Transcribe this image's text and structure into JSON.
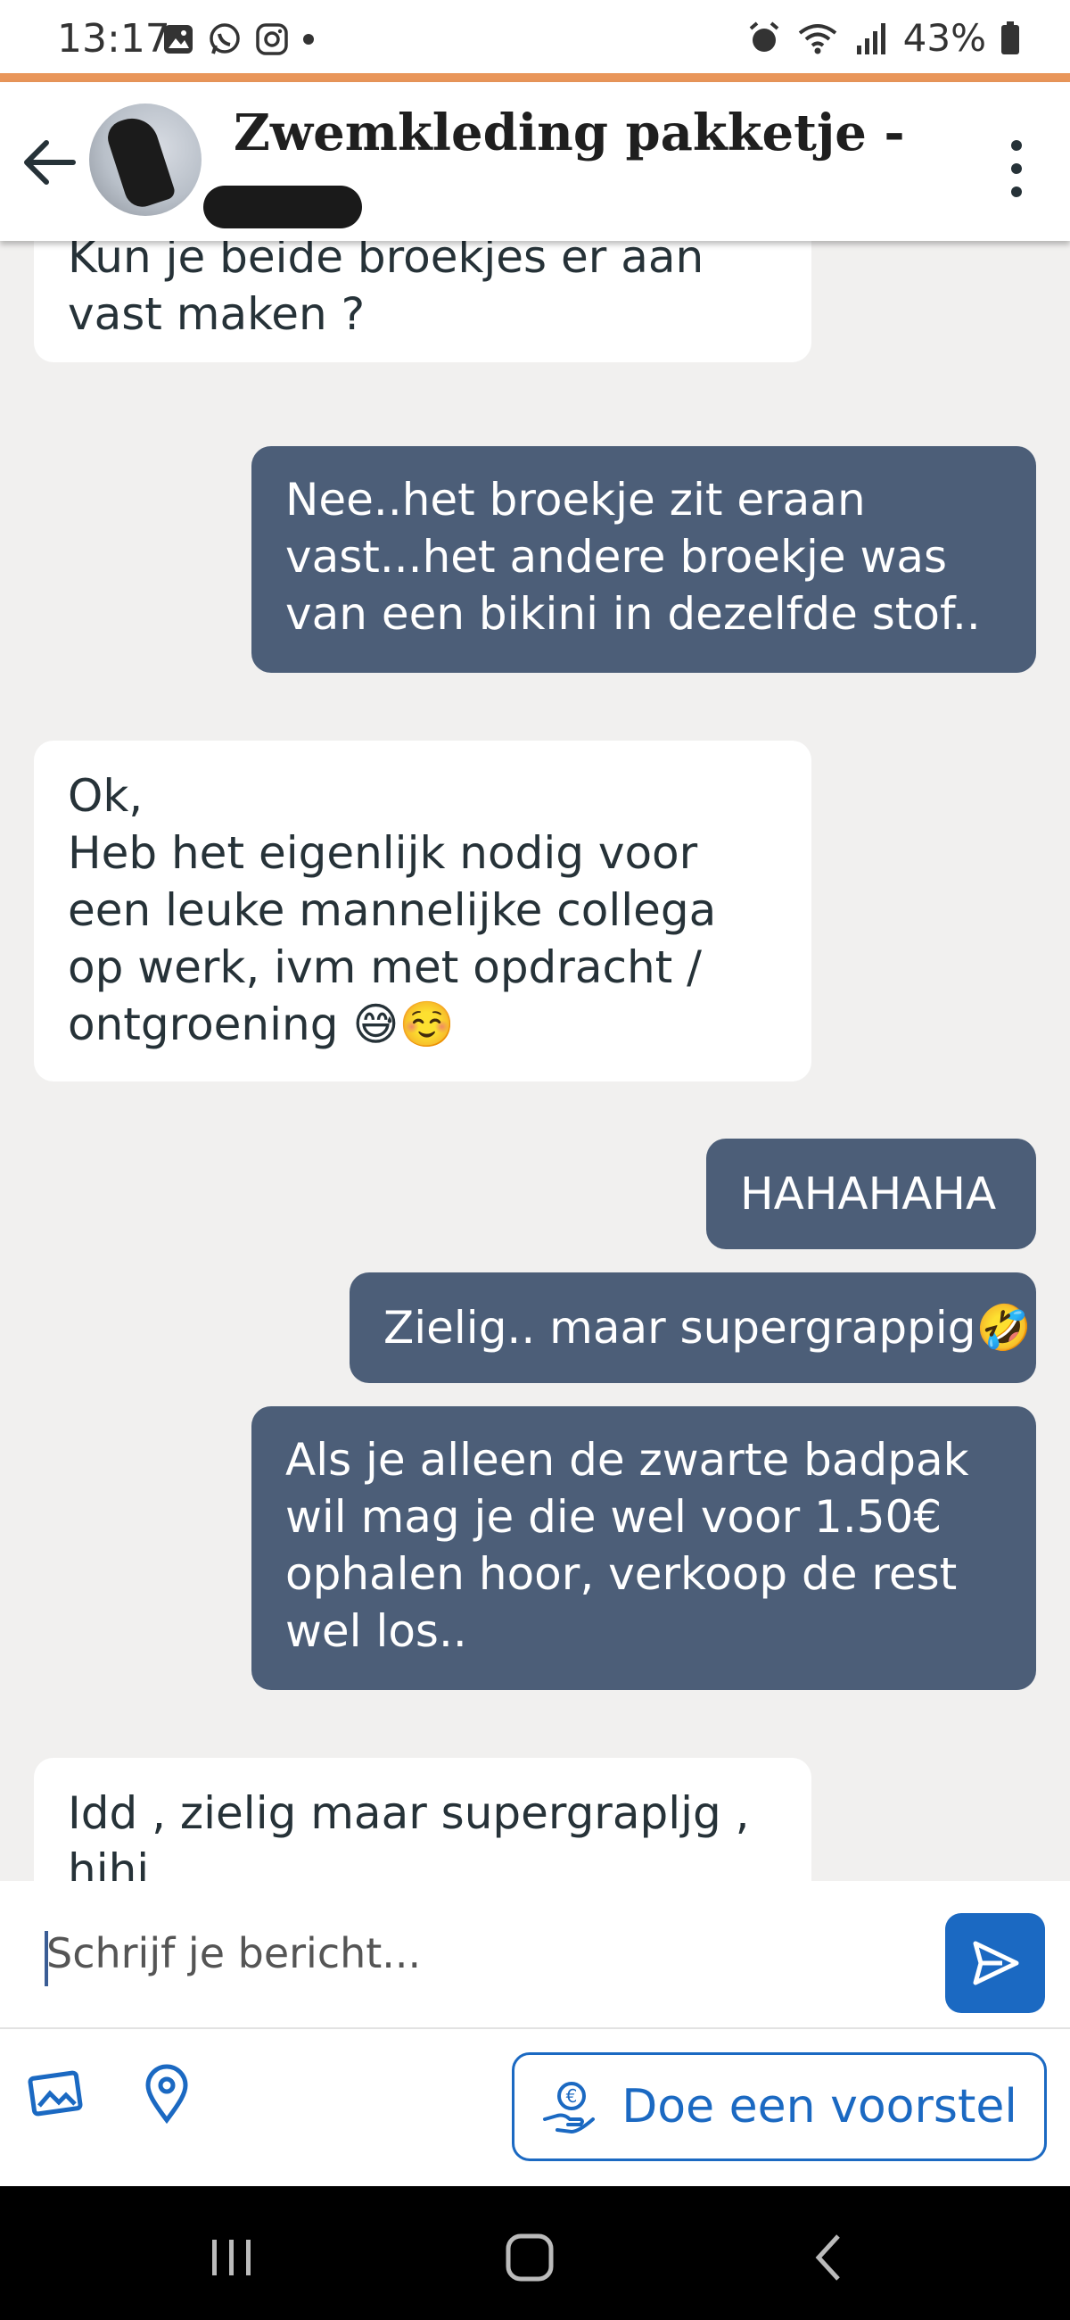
{
  "status_bar": {
    "time": "13:17",
    "battery": "43%"
  },
  "header": {
    "title": "Zwemkleding pakketje - €...",
    "back_icon": "arrow-left-icon",
    "menu_icon": "kebab-menu-icon"
  },
  "messages": [
    {
      "side": "in",
      "text": "Kun je beide broekjes er aan\nvast maken ?"
    },
    {
      "side": "out",
      "text": "Nee..het broekje zit eraan\nvast...het andere broekje was\nvan een bikini in dezelfde stof.."
    },
    {
      "side": "in",
      "text": "Ok,\nHeb het eigenlijk nodig voor\neen leuke mannelijke collega\nop werk, ivm met opdracht /\nontgroening 😅☺️"
    },
    {
      "side": "out",
      "text": "HAHAHAHA"
    },
    {
      "side": "out",
      "text": "Zielig.. maar supergrappig🤣"
    },
    {
      "side": "out",
      "text": "Als je alleen de zwarte badpak\nwil mag je die wel voor 1.50€\nophalen hoor, verkoop de rest\nwel los.."
    },
    {
      "side": "in",
      "text": "Idd , zielig maar supergrapljg ,\nhihi"
    }
  ],
  "composer": {
    "placeholder": "Schrijf je bericht..."
  },
  "toolbar": {
    "offer_label": "Doe een voorstel"
  },
  "colors": {
    "accent": "#1b69c2",
    "outgoing_bubble": "#4c5e78",
    "status_line": "#e9965a"
  }
}
